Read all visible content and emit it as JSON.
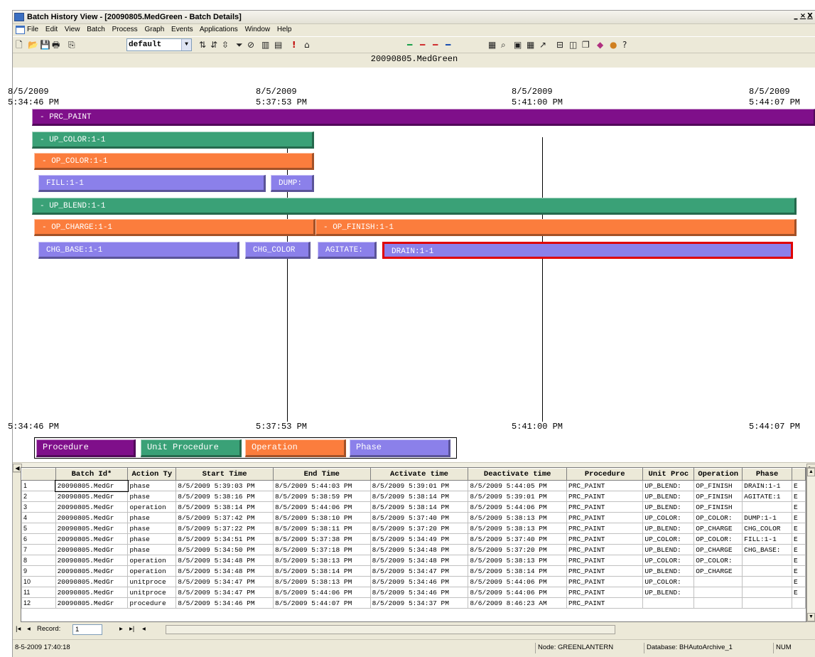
{
  "window": {
    "title": "Batch History View - [20090805.MedGreen - Batch Details]",
    "minimize": "_",
    "restore": "×",
    "close": "X"
  },
  "menu": [
    "File",
    "Edit",
    "View",
    "Batch",
    "Process",
    "Graph",
    "Events",
    "Applications",
    "Window",
    "Help"
  ],
  "toolbar": {
    "view_combo_value": "default",
    "combo_arrow": "▼"
  },
  "chart": {
    "batch_title": "20090805.MedGreen",
    "top_ticks": [
      {
        "date": "8/5/2009",
        "time": "5:34:46 PM"
      },
      {
        "date": "8/5/2009",
        "time": "5:37:53 PM"
      },
      {
        "date": "8/5/2009",
        "time": "5:41:00 PM"
      },
      {
        "date": "8/5/2009",
        "time": "5:44:07 PM"
      }
    ],
    "bottom_ticks": [
      "5:34:46 PM",
      "5:37:53 PM",
      "5:41:00 PM",
      "5:44:07 PM"
    ],
    "bars": {
      "prc_paint": "- PRC_PAINT",
      "up_color": "- UP_COLOR:1-1",
      "op_color": "- OP_COLOR:1-1",
      "fill": "FILL:1-1",
      "dump": "DUMP:",
      "up_blend": "- UP_BLEND:1-1",
      "op_charge": "- OP_CHARGE:1-1",
      "op_finish": "- OP_FINISH:1-1",
      "chg_base": "CHG_BASE:1-1",
      "chg_color": "CHG_COLOR",
      "agitate": "AGITATE:",
      "drain": "DRAIN:1-1"
    },
    "legend": {
      "procedure": "Procedure",
      "unit_procedure": "Unit Procedure",
      "operation": "Operation",
      "phase": "Phase"
    },
    "colors": {
      "procedure": "#7f0f8a",
      "unit_procedure": "#3aa177",
      "operation": "#fb7d3d",
      "phase": "#8b80ea",
      "selection": "#e00000"
    }
  },
  "grid": {
    "columns": [
      "Batch Id*",
      "Action Ty",
      "Start Time",
      "End Time",
      "Activate time",
      "Deactivate time",
      "Procedure",
      "Unit Proc",
      "Operation",
      "Phase"
    ],
    "rows": [
      {
        "n": "1",
        "cells": [
          "20090805.MedGr",
          "phase",
          "8/5/2009 5:39:03 PM",
          "8/5/2009 5:44:03 PM",
          "8/5/2009 5:39:01 PM",
          "8/5/2009 5:44:05 PM",
          "PRC_PAINT",
          "UP_BLEND:",
          "OP_FINISH",
          "DRAIN:1-1",
          "E"
        ]
      },
      {
        "n": "2",
        "cells": [
          "20090805.MedGr",
          "phase",
          "8/5/2009 5:38:16 PM",
          "8/5/2009 5:38:59 PM",
          "8/5/2009 5:38:14 PM",
          "8/5/2009 5:39:01 PM",
          "PRC_PAINT",
          "UP_BLEND:",
          "OP_FINISH",
          "AGITATE:1",
          "E"
        ]
      },
      {
        "n": "3",
        "cells": [
          "20090805.MedGr",
          "operation",
          "8/5/2009 5:38:14 PM",
          "8/5/2009 5:44:06 PM",
          "8/5/2009 5:38:14 PM",
          "8/5/2009 5:44:06 PM",
          "PRC_PAINT",
          "UP_BLEND:",
          "OP_FINISH",
          "",
          "E"
        ]
      },
      {
        "n": "4",
        "cells": [
          "20090805.MedGr",
          "phase",
          "8/5/2009 5:37:42 PM",
          "8/5/2009 5:38:10 PM",
          "8/5/2009 5:37:40 PM",
          "8/5/2009 5:38:13 PM",
          "PRC_PAINT",
          "UP_COLOR:",
          "OP_COLOR:",
          "DUMP:1-1",
          "E"
        ]
      },
      {
        "n": "5",
        "cells": [
          "20090805.MedGr",
          "phase",
          "8/5/2009 5:37:22 PM",
          "8/5/2009 5:38:11 PM",
          "8/5/2009 5:37:20 PM",
          "8/5/2009 5:38:13 PM",
          "PRC_PAINT",
          "UP_BLEND:",
          "OP_CHARGE",
          "CHG_COLOR",
          "E"
        ]
      },
      {
        "n": "6",
        "cells": [
          "20090805.MedGr",
          "phase",
          "8/5/2009 5:34:51 PM",
          "8/5/2009 5:37:38 PM",
          "8/5/2009 5:34:49 PM",
          "8/5/2009 5:37:40 PM",
          "PRC_PAINT",
          "UP_COLOR:",
          "OP_COLOR:",
          "FILL:1-1",
          "E"
        ]
      },
      {
        "n": "7",
        "cells": [
          "20090805.MedGr",
          "phase",
          "8/5/2009 5:34:50 PM",
          "8/5/2009 5:37:18 PM",
          "8/5/2009 5:34:48 PM",
          "8/5/2009 5:37:20 PM",
          "PRC_PAINT",
          "UP_BLEND:",
          "OP_CHARGE",
          "CHG_BASE:",
          "E"
        ]
      },
      {
        "n": "8",
        "cells": [
          "20090805.MedGr",
          "operation",
          "8/5/2009 5:34:48 PM",
          "8/5/2009 5:38:13 PM",
          "8/5/2009 5:34:48 PM",
          "8/5/2009 5:38:13 PM",
          "PRC_PAINT",
          "UP_COLOR:",
          "OP_COLOR:",
          "",
          "E"
        ]
      },
      {
        "n": "9",
        "cells": [
          "20090805.MedGr",
          "operation",
          "8/5/2009 5:34:48 PM",
          "8/5/2009 5:38:14 PM",
          "8/5/2009 5:34:47 PM",
          "8/5/2009 5:38:14 PM",
          "PRC_PAINT",
          "UP_BLEND:",
          "OP_CHARGE",
          "",
          "E"
        ]
      },
      {
        "n": "10",
        "cells": [
          "20090805.MedGr",
          "unitproce",
          "8/5/2009 5:34:47 PM",
          "8/5/2009 5:38:13 PM",
          "8/5/2009 5:34:46 PM",
          "8/5/2009 5:44:06 PM",
          "PRC_PAINT",
          "UP_COLOR:",
          "",
          "",
          "E"
        ]
      },
      {
        "n": "11",
        "cells": [
          "20090805.MedGr",
          "unitproce",
          "8/5/2009 5:34:47 PM",
          "8/5/2009 5:44:06 PM",
          "8/5/2009 5:34:46 PM",
          "8/5/2009 5:44:06 PM",
          "PRC_PAINT",
          "UP_BLEND:",
          "",
          "",
          "E"
        ]
      },
      {
        "n": "12",
        "cells": [
          "20090805.MedGr",
          "procedure",
          "8/5/2009 5:34:46 PM",
          "8/5/2009 5:44:07 PM",
          "8/5/2009 5:34:37 PM",
          "8/6/2009 8:46:23 AM",
          "PRC_PAINT",
          "",
          "",
          "",
          ""
        ]
      }
    ]
  },
  "navigation": {
    "record_label": "Record:",
    "record_value": "1"
  },
  "status": {
    "datetime": "8-5-2009 17:40:18",
    "node": "Node: GREENLANTERN",
    "database": "Database: BHAutoArchive_1",
    "num": "NUM"
  }
}
